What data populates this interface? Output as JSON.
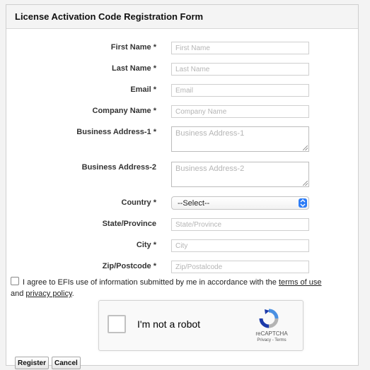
{
  "form": {
    "title": "License Activation Code Registration Form",
    "fields": [
      {
        "label": "First Name *",
        "placeholder": "First Name"
      },
      {
        "label": "Last Name *",
        "placeholder": "Last Name"
      },
      {
        "label": "Email *",
        "placeholder": "Email"
      },
      {
        "label": "Company Name *",
        "placeholder": "Company Name"
      },
      {
        "label": "Business Address-1 *",
        "placeholder": "Business Address-1"
      },
      {
        "label": "Business Address-2",
        "placeholder": "Business Address-2"
      },
      {
        "label": "Country *",
        "selected": "--Select--"
      },
      {
        "label": "State/Province",
        "placeholder": "State/Province"
      },
      {
        "label": "City *",
        "placeholder": "City"
      },
      {
        "label": "Zip/Postcode *",
        "placeholder": "Zip/Postalcode"
      }
    ],
    "agreement": {
      "text_before": "I agree to EFIs use of information submitted by me in accordance with the ",
      "terms_link": "terms of use",
      "text_middle": " and ",
      "privacy_link": "privacy policy",
      "text_after": "."
    },
    "captcha": {
      "label": "I'm not a robot",
      "brand": "reCAPTCHA",
      "links": "Privacy - Terms"
    },
    "buttons": {
      "register": "Register",
      "cancel": "Cancel"
    }
  },
  "colors": {
    "select_arrow": "#2d7cf6",
    "recaptcha_blue": "#4a90e2",
    "recaptcha_dark": "#1c3aa9"
  }
}
